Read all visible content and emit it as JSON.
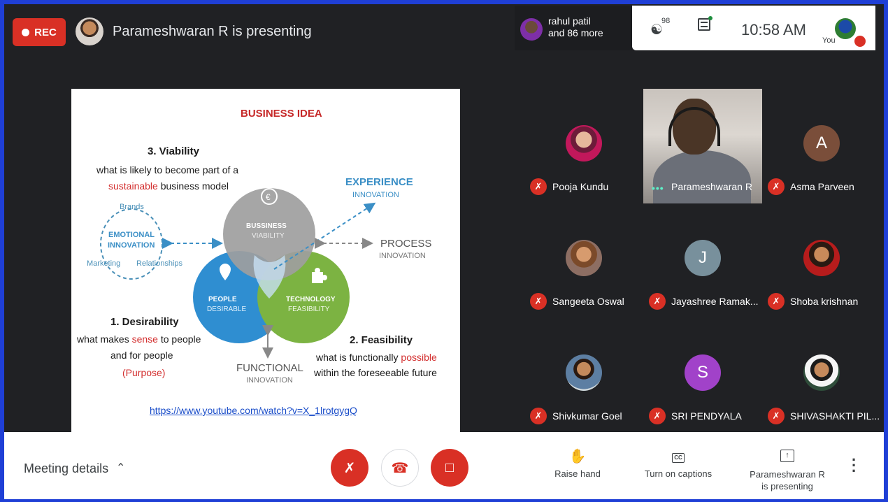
{
  "recording": {
    "label": "REC"
  },
  "presenter_banner": {
    "text": "Parameshwaran R is presenting"
  },
  "header": {
    "raised_notice_name": "rahul patil",
    "raised_notice_more": "and 86 more",
    "people_count": "98",
    "time": "10:58 AM",
    "self_label": "You"
  },
  "slide": {
    "title": "BUSINESS IDEA",
    "viability_heading": "3. Viability",
    "viability_line1": "what is likely to become part of a",
    "viability_line2_highlight": "sustainable",
    "viability_line2_rest": " business model",
    "desirability_heading": "1. Desirability",
    "desirability_line1_pre": "what makes ",
    "desirability_line1_highlight": "sense",
    "desirability_line1_post": " to people",
    "desirability_line2": "and for people",
    "desirability_line3": "(Purpose)",
    "feasibility_heading": "2. Feasibility",
    "feasibility_line1_pre": "what is functionally ",
    "feasibility_line1_highlight": "possible",
    "feasibility_line2": "within the foreseeable future",
    "experience": "EXPERIENCE",
    "experience_sub": "INNOVATION",
    "process": "PROCESS",
    "process_sub": "INNOVATION",
    "functional": "FUNCTIONAL",
    "functional_sub": "INNOVATION",
    "brands": "Brands",
    "emotional_1": "EMOTIONAL",
    "emotional_2": "INNOVATION",
    "marketing": "Marketing",
    "relationships": "Relationships",
    "business_1": "BUSSINESS",
    "business_2": "VIABILITY",
    "people_1": "PEOPLE",
    "people_2": "DESIRABLE",
    "technology_1": "TECHNOLOGY",
    "technology_2": "FEASIBILITY",
    "link": "https://www.youtube.com/watch?v=X_1lrotgygQ",
    "colors": {
      "business": "#9e9e9e",
      "people": "#2f8ed1",
      "technology": "#7cb342",
      "accent_red": "#d32f2f",
      "accent_blue": "#3b8fc6"
    }
  },
  "participants": [
    {
      "name": "Pooja Kundu",
      "initial": "",
      "color": "#c2185b",
      "muted": true,
      "photo": true
    },
    {
      "name": "Parameshwaran R",
      "initial": "",
      "color": "#6b6f78",
      "muted": false,
      "video": true
    },
    {
      "name": "Asma Parveen",
      "initial": "A",
      "color": "#7a4e3a",
      "muted": true
    },
    {
      "name": "Sangeeta Oswal",
      "initial": "",
      "color": "#8d6e63",
      "muted": true,
      "photo": true
    },
    {
      "name": "Jayashree Ramak...",
      "initial": "J",
      "color": "#78909c",
      "muted": true
    },
    {
      "name": "Shoba krishnan",
      "initial": "",
      "color": "#b71c1c",
      "muted": true,
      "photo": true
    },
    {
      "name": "Shivkumar Goel",
      "initial": "",
      "color": "#5d7fa3",
      "muted": true,
      "photo": true
    },
    {
      "name": "SRI PENDYALA",
      "initial": "S",
      "color": "#a142c9",
      "muted": true
    },
    {
      "name": "SHIVASHAKTI PIL...",
      "initial": "",
      "color": "#2e4d3a",
      "muted": true,
      "photo": true
    }
  ],
  "footer": {
    "meeting_details": "Meeting details",
    "raise_hand": "Raise hand",
    "captions": "Turn on captions",
    "captions_icon_text": "CC",
    "presenting_line1": "Parameshwaran R",
    "presenting_line2": "is presenting"
  },
  "icons": [
    "record-dot-icon",
    "people-icon",
    "chat-icon",
    "mic-off-icon",
    "end-call-icon",
    "camera-off-icon",
    "hand-icon",
    "captions-icon",
    "present-icon",
    "more-vert-icon"
  ]
}
